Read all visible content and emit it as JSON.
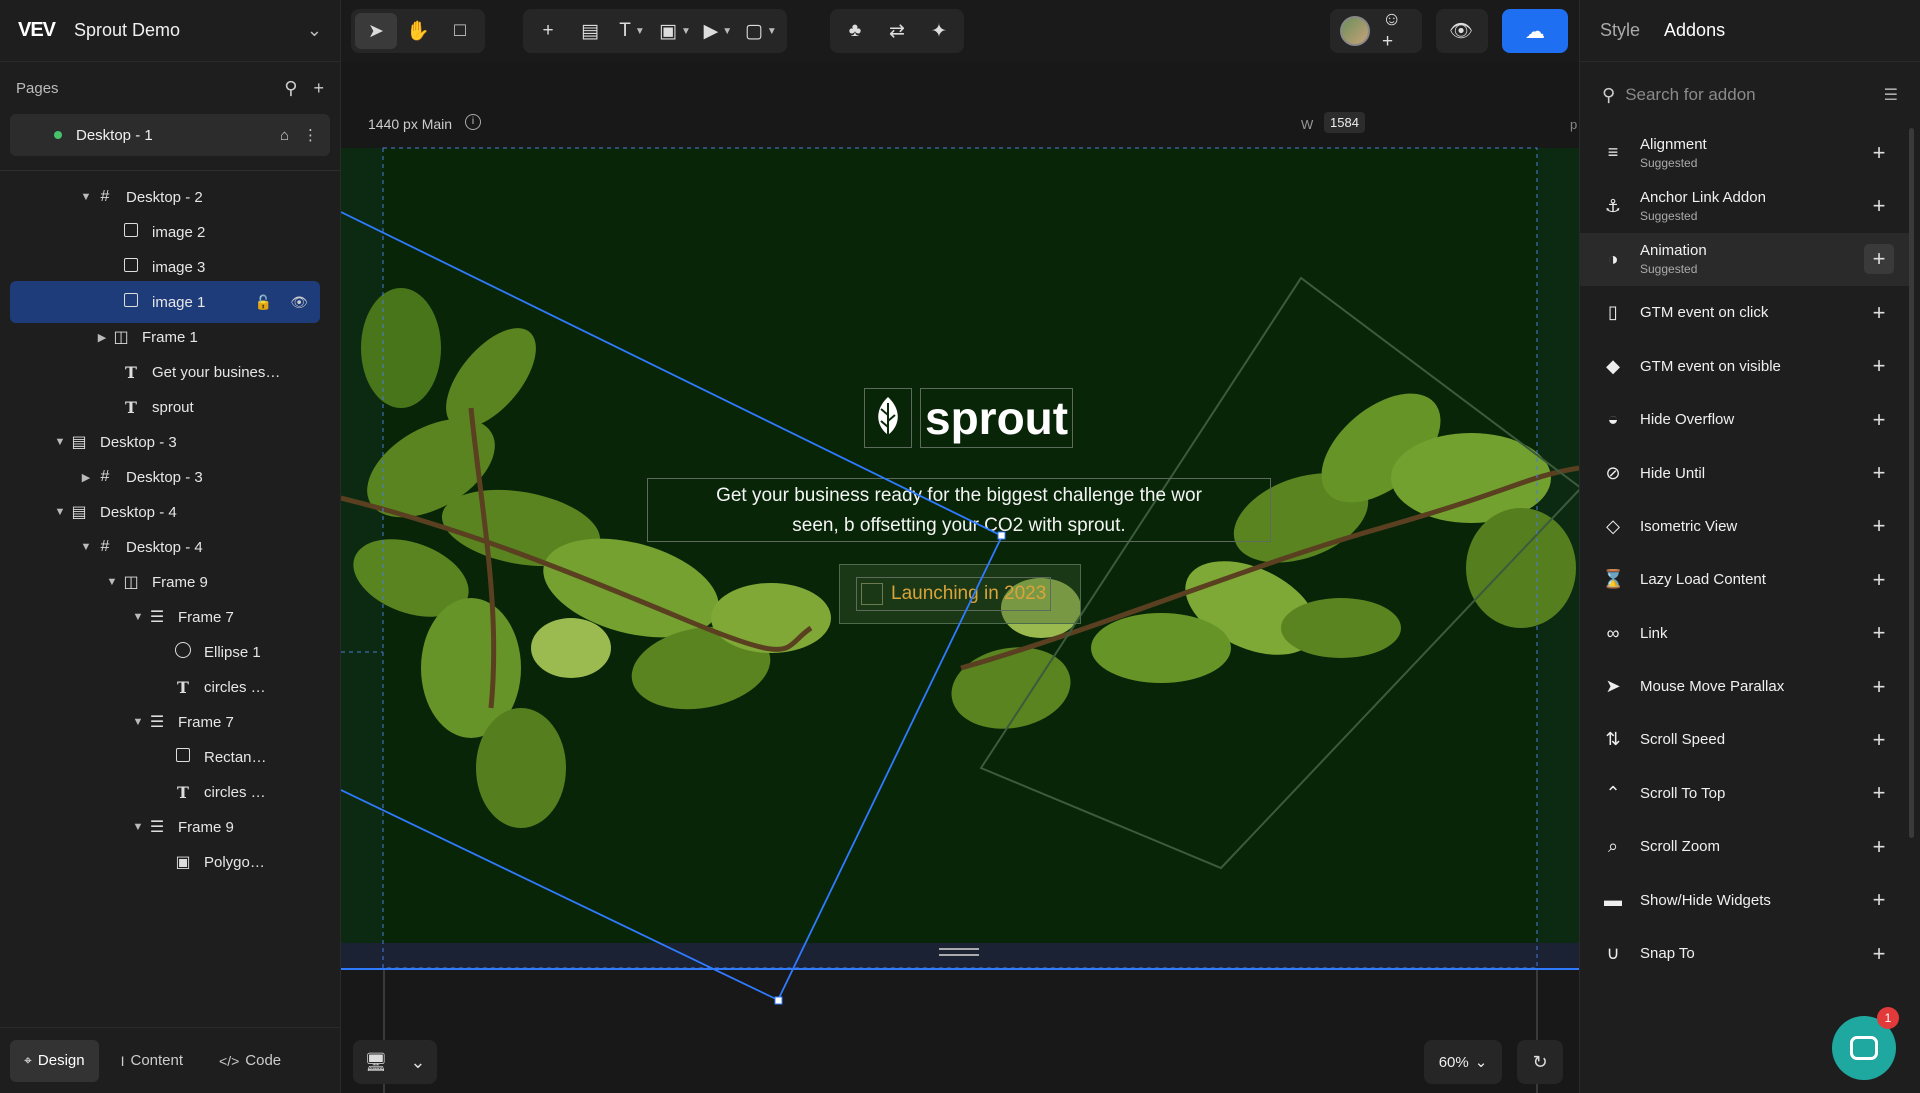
{
  "project": {
    "logo": "VEV",
    "name": "Sprout Demo"
  },
  "pages": {
    "label": "Pages",
    "active_page": "Desktop - 1"
  },
  "layers": [
    {
      "label": "Desktop - 2",
      "icon": "hash-icon"
    },
    {
      "label": "image 2",
      "icon": "image-square-icon"
    },
    {
      "label": "image 3",
      "icon": "image-square-icon"
    },
    {
      "label": "image 1",
      "icon": "image-square-icon"
    },
    {
      "label": "Frame 1",
      "icon": "columns-icon"
    },
    {
      "label": "Get your busines…",
      "icon": "text-icon"
    },
    {
      "label": "sprout",
      "icon": "text-icon"
    },
    {
      "label": "Desktop - 3",
      "icon": "section-icon"
    },
    {
      "label": "Desktop - 3",
      "icon": "hash-icon"
    },
    {
      "label": "Desktop - 4",
      "icon": "section-icon"
    },
    {
      "label": "Desktop - 4",
      "icon": "hash-icon"
    },
    {
      "label": "Frame 9",
      "icon": "columns-icon"
    },
    {
      "label": "Frame 7",
      "icon": "rows-icon"
    },
    {
      "label": "Ellipse 1",
      "icon": "ellipse-icon"
    },
    {
      "label": "circles …",
      "icon": "text-icon"
    },
    {
      "label": "Frame 7",
      "icon": "rows-icon"
    },
    {
      "label": "Rectan…",
      "icon": "image-square-icon"
    },
    {
      "label": "circles …",
      "icon": "text-icon"
    },
    {
      "label": "Frame 9",
      "icon": "rows-icon"
    },
    {
      "label": "Polygo…",
      "icon": "picture-icon"
    }
  ],
  "left_tabs": {
    "design": "Design",
    "content": "Content",
    "code": "Code"
  },
  "canvas": {
    "frame_name": "1440 px Main",
    "width_label": "W",
    "width_value": "1584",
    "width_unit": "p",
    "brand": "sprout",
    "tagline_line1": "Get your business ready for the biggest challenge the wor",
    "tagline_line2": "seen, b  offsetting your CO2 with sprout.",
    "launch": "Launching in 2023",
    "zoom": "60%"
  },
  "right_panel": {
    "tab_style": "Style",
    "tab_addons": "Addons",
    "search_placeholder": "Search for addon",
    "addons": [
      {
        "name": "Alignment",
        "sub": "Suggested",
        "icon": "align-left-icon"
      },
      {
        "name": "Anchor Link Addon",
        "sub": "Suggested",
        "icon": "anchor-icon"
      },
      {
        "name": "Animation",
        "sub": "Suggested",
        "icon": "animation-icon"
      },
      {
        "name": "GTM event on click",
        "sub": "",
        "icon": "mouse-icon"
      },
      {
        "name": "GTM event on visible",
        "sub": "",
        "icon": "diamond-icon"
      },
      {
        "name": "Hide Overflow",
        "sub": "",
        "icon": "hide-overflow-icon"
      },
      {
        "name": "Hide Until",
        "sub": "",
        "icon": "eye-slash-icon"
      },
      {
        "name": "Isometric View",
        "sub": "",
        "icon": "isometric-icon"
      },
      {
        "name": "Lazy Load Content",
        "sub": "",
        "icon": "hourglass-icon"
      },
      {
        "name": "Link",
        "sub": "",
        "icon": "link-icon"
      },
      {
        "name": "Mouse Move Parallax",
        "sub": "",
        "icon": "cursor-icon"
      },
      {
        "name": "Scroll Speed",
        "sub": "",
        "icon": "scroll-speed-icon"
      },
      {
        "name": "Scroll To Top",
        "sub": "",
        "icon": "scroll-top-icon"
      },
      {
        "name": "Scroll Zoom",
        "sub": "",
        "icon": "zoom-icon"
      },
      {
        "name": "Show/Hide Widgets",
        "sub": "",
        "icon": "toggle-icon"
      },
      {
        "name": "Snap To",
        "sub": "",
        "icon": "magnet-icon"
      }
    ]
  },
  "chat_badge": "1",
  "colors": {
    "accent": "#1e6ff2",
    "selection": "#1f3c7a",
    "canvas_green": "#082508",
    "launch_text": "#d9a43a",
    "chat": "#1fa8a0"
  }
}
